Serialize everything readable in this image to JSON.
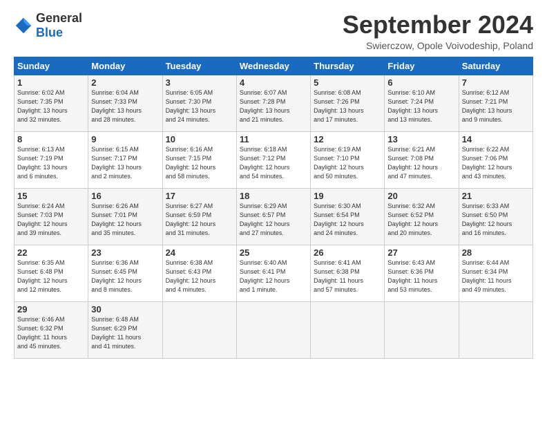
{
  "logo": {
    "text_general": "General",
    "text_blue": "Blue"
  },
  "title": "September 2024",
  "location": "Swierczow, Opole Voivodeship, Poland",
  "headers": [
    "Sunday",
    "Monday",
    "Tuesday",
    "Wednesday",
    "Thursday",
    "Friday",
    "Saturday"
  ],
  "weeks": [
    [
      {
        "num": "1",
        "detail": "Sunrise: 6:02 AM\nSunset: 7:35 PM\nDaylight: 13 hours\nand 32 minutes."
      },
      {
        "num": "2",
        "detail": "Sunrise: 6:04 AM\nSunset: 7:33 PM\nDaylight: 13 hours\nand 28 minutes."
      },
      {
        "num": "3",
        "detail": "Sunrise: 6:05 AM\nSunset: 7:30 PM\nDaylight: 13 hours\nand 24 minutes."
      },
      {
        "num": "4",
        "detail": "Sunrise: 6:07 AM\nSunset: 7:28 PM\nDaylight: 13 hours\nand 21 minutes."
      },
      {
        "num": "5",
        "detail": "Sunrise: 6:08 AM\nSunset: 7:26 PM\nDaylight: 13 hours\nand 17 minutes."
      },
      {
        "num": "6",
        "detail": "Sunrise: 6:10 AM\nSunset: 7:24 PM\nDaylight: 13 hours\nand 13 minutes."
      },
      {
        "num": "7",
        "detail": "Sunrise: 6:12 AM\nSunset: 7:21 PM\nDaylight: 13 hours\nand 9 minutes."
      }
    ],
    [
      {
        "num": "8",
        "detail": "Sunrise: 6:13 AM\nSunset: 7:19 PM\nDaylight: 13 hours\nand 6 minutes."
      },
      {
        "num": "9",
        "detail": "Sunrise: 6:15 AM\nSunset: 7:17 PM\nDaylight: 13 hours\nand 2 minutes."
      },
      {
        "num": "10",
        "detail": "Sunrise: 6:16 AM\nSunset: 7:15 PM\nDaylight: 12 hours\nand 58 minutes."
      },
      {
        "num": "11",
        "detail": "Sunrise: 6:18 AM\nSunset: 7:12 PM\nDaylight: 12 hours\nand 54 minutes."
      },
      {
        "num": "12",
        "detail": "Sunrise: 6:19 AM\nSunset: 7:10 PM\nDaylight: 12 hours\nand 50 minutes."
      },
      {
        "num": "13",
        "detail": "Sunrise: 6:21 AM\nSunset: 7:08 PM\nDaylight: 12 hours\nand 47 minutes."
      },
      {
        "num": "14",
        "detail": "Sunrise: 6:22 AM\nSunset: 7:06 PM\nDaylight: 12 hours\nand 43 minutes."
      }
    ],
    [
      {
        "num": "15",
        "detail": "Sunrise: 6:24 AM\nSunset: 7:03 PM\nDaylight: 12 hours\nand 39 minutes."
      },
      {
        "num": "16",
        "detail": "Sunrise: 6:26 AM\nSunset: 7:01 PM\nDaylight: 12 hours\nand 35 minutes."
      },
      {
        "num": "17",
        "detail": "Sunrise: 6:27 AM\nSunset: 6:59 PM\nDaylight: 12 hours\nand 31 minutes."
      },
      {
        "num": "18",
        "detail": "Sunrise: 6:29 AM\nSunset: 6:57 PM\nDaylight: 12 hours\nand 27 minutes."
      },
      {
        "num": "19",
        "detail": "Sunrise: 6:30 AM\nSunset: 6:54 PM\nDaylight: 12 hours\nand 24 minutes."
      },
      {
        "num": "20",
        "detail": "Sunrise: 6:32 AM\nSunset: 6:52 PM\nDaylight: 12 hours\nand 20 minutes."
      },
      {
        "num": "21",
        "detail": "Sunrise: 6:33 AM\nSunset: 6:50 PM\nDaylight: 12 hours\nand 16 minutes."
      }
    ],
    [
      {
        "num": "22",
        "detail": "Sunrise: 6:35 AM\nSunset: 6:48 PM\nDaylight: 12 hours\nand 12 minutes."
      },
      {
        "num": "23",
        "detail": "Sunrise: 6:36 AM\nSunset: 6:45 PM\nDaylight: 12 hours\nand 8 minutes."
      },
      {
        "num": "24",
        "detail": "Sunrise: 6:38 AM\nSunset: 6:43 PM\nDaylight: 12 hours\nand 4 minutes."
      },
      {
        "num": "25",
        "detail": "Sunrise: 6:40 AM\nSunset: 6:41 PM\nDaylight: 12 hours\nand 1 minute."
      },
      {
        "num": "26",
        "detail": "Sunrise: 6:41 AM\nSunset: 6:38 PM\nDaylight: 11 hours\nand 57 minutes."
      },
      {
        "num": "27",
        "detail": "Sunrise: 6:43 AM\nSunset: 6:36 PM\nDaylight: 11 hours\nand 53 minutes."
      },
      {
        "num": "28",
        "detail": "Sunrise: 6:44 AM\nSunset: 6:34 PM\nDaylight: 11 hours\nand 49 minutes."
      }
    ],
    [
      {
        "num": "29",
        "detail": "Sunrise: 6:46 AM\nSunset: 6:32 PM\nDaylight: 11 hours\nand 45 minutes."
      },
      {
        "num": "30",
        "detail": "Sunrise: 6:48 AM\nSunset: 6:29 PM\nDaylight: 11 hours\nand 41 minutes."
      },
      {
        "num": "",
        "detail": ""
      },
      {
        "num": "",
        "detail": ""
      },
      {
        "num": "",
        "detail": ""
      },
      {
        "num": "",
        "detail": ""
      },
      {
        "num": "",
        "detail": ""
      }
    ]
  ]
}
